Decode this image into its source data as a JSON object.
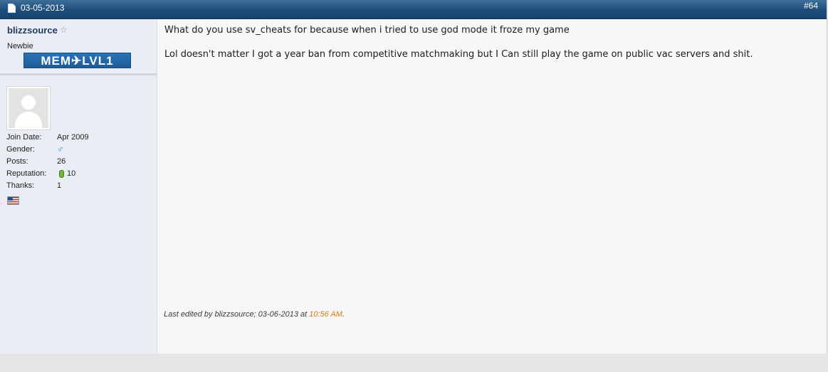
{
  "post": {
    "date": "03-05-2013",
    "number": "#64"
  },
  "user": {
    "username": "blizzsource",
    "title": "Newbie",
    "rank_badge": "MEM✈LVL1",
    "details": [
      {
        "label": "Join Date:",
        "value": "Apr 2009"
      },
      {
        "label": "Gender:",
        "value": ""
      },
      {
        "label": "Posts:",
        "value": "26"
      },
      {
        "label": "Reputation:",
        "value": "10"
      },
      {
        "label": "Thanks:",
        "value": "1"
      }
    ],
    "gender_icon": "male-symbol-icon",
    "flag_icon": "us-flag-icon",
    "status_icon": "offline-star-icon"
  },
  "message": {
    "lines": [
      "What do you use sv_cheats for because when i tried to use god mode it froze my game",
      "Lol doesn't matter I got a year ban from competitive matchmaking but I Can still play the game on public vac servers and shit."
    ]
  },
  "last_edit": {
    "prefix": "Last edited by blizzsource; 03-06-2013 at ",
    "time": "10:56 AM",
    "suffix": "."
  },
  "colors": {
    "header_bar": "#1d4c7a",
    "username": "#1f3a5f",
    "edit_time": "#e07a10",
    "reputation": "#74b836"
  }
}
